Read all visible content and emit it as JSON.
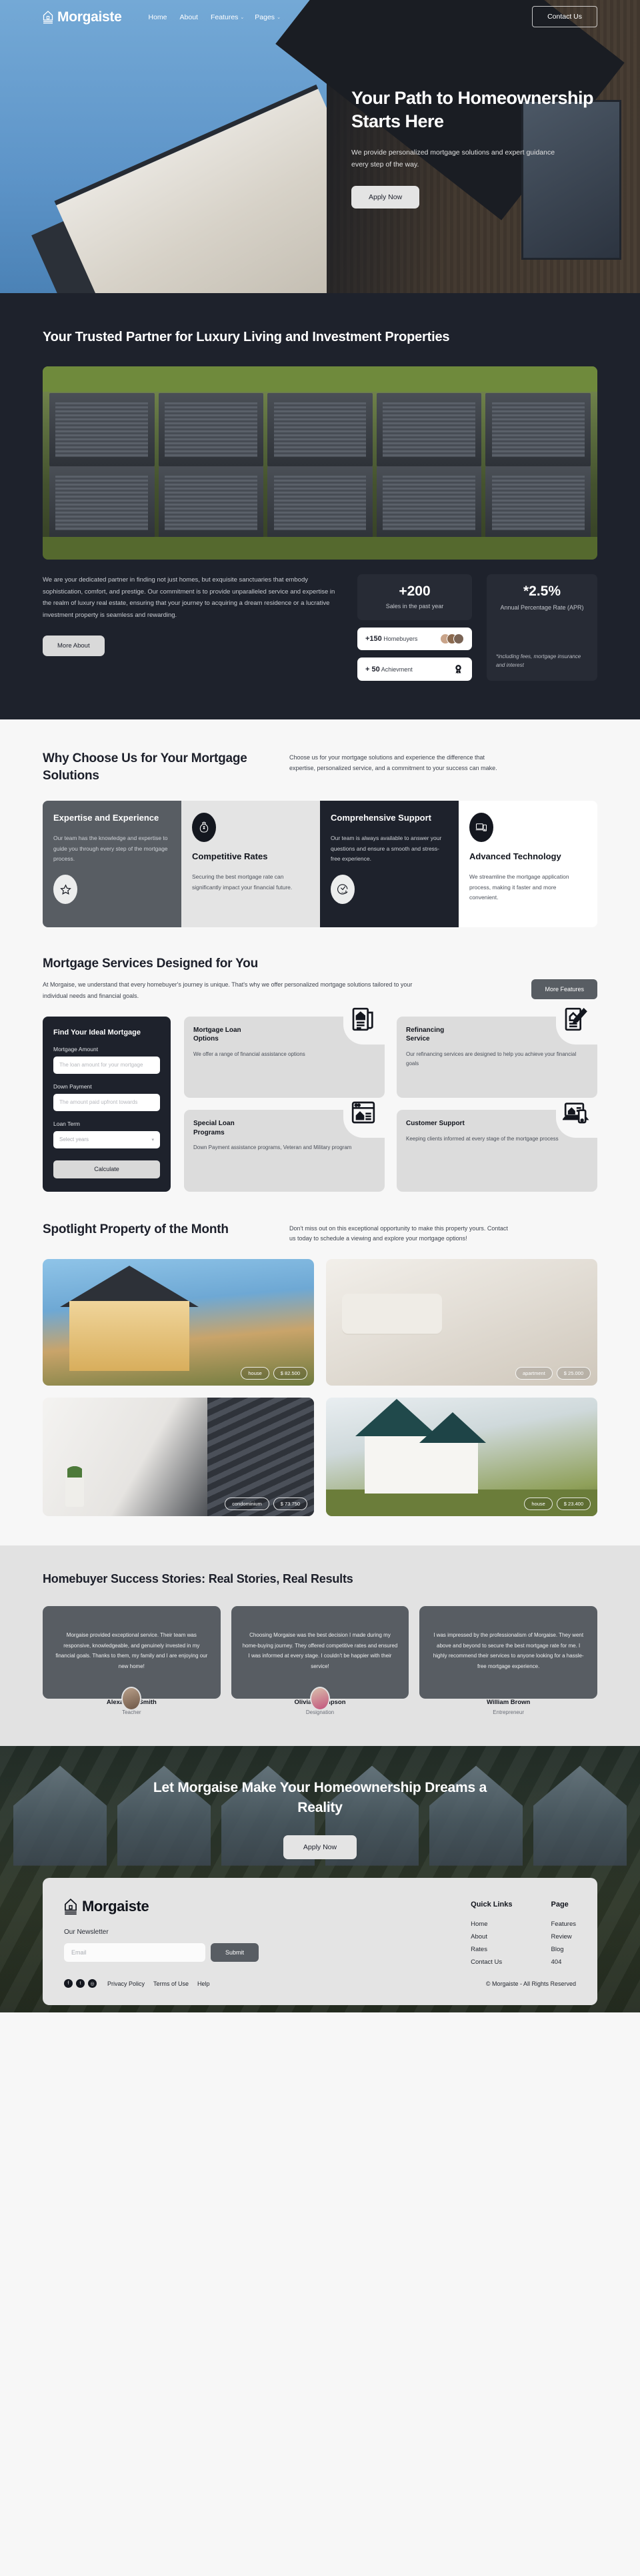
{
  "brand": {
    "name": "Morgaiste",
    "icon": "house-logo-icon"
  },
  "nav": {
    "links": [
      {
        "label": "Home",
        "caret": ""
      },
      {
        "label": "About",
        "caret": ""
      },
      {
        "label": "Features",
        "caret": "⌄"
      },
      {
        "label": "Pages",
        "caret": "⌄"
      }
    ],
    "cta": "Contact Us"
  },
  "hero": {
    "title": "Your Path to Homeownership Starts Here",
    "subtitle": "We provide personalized mortgage solutions and expert guidance every step of the way.",
    "cta": "Apply Now"
  },
  "about": {
    "heading": "Your Trusted Partner for Luxury Living and Investment Properties",
    "body": "We are your dedicated partner in finding not just homes, but exquisite sanctuaries that embody sophistication, comfort, and prestige. Our commitment is to provide unparalleled service and expertise in the realm of luxury real estate, ensuring that your journey to acquiring a dream residence or a lucrative investment property is seamless and rewarding.",
    "cta": "More About",
    "stat_sales_value": "+200",
    "stat_sales_label": "Sales in the past year",
    "pill_homebuyers_value": "+150",
    "pill_homebuyers_label": "Homebuyers",
    "pill_achievement_value": "+ 50",
    "pill_achievement_label": "Achievment",
    "apr_value": "*2.5%",
    "apr_label": "Annual Percentage Rate (APR)",
    "apr_note": "*including fees, mortgage insurance and interest"
  },
  "why": {
    "heading": "Why Choose Us for Your Mortgage Solutions",
    "body": "Choose us for your mortgage solutions and experience the difference that expertise, personalized service, and a commitment to your success can make.",
    "cards": [
      {
        "title": "Expertise and Experience",
        "body": "Our team has the knowledge and expertise to guide you through every step of the mortgage process.",
        "icon": "star-icon"
      },
      {
        "title": "Competitive Rates",
        "body": "Securing the best mortgage rate can significantly impact your financial future.",
        "icon": "money-bag-icon"
      },
      {
        "title": "Comprehensive Support",
        "body": "Our team is always available to answer your questions and ensure a smooth and stress-free experience.",
        "icon": "24-hour-clock-icon"
      },
      {
        "title": "Advanced Technology",
        "body": "We streamline the mortgage application process, making it faster and more convenient.",
        "icon": "devices-icon"
      }
    ]
  },
  "services": {
    "heading": "Mortgage Services Designed for You",
    "body": "At Morgaise, we understand that every homebuyer's journey is unique. That's why we offer personalized mortgage solutions tailored to your individual needs and financial goals.",
    "cta": "More Features",
    "calculator": {
      "title": "Find Your Ideal Mortgage",
      "amount_label": "Mortgage Amount",
      "amount_placeholder": "The loan amount for your mortgage",
      "down_label": "Down Payment",
      "down_placeholder": "The amount paid upfront towards",
      "term_label": "Loan Term",
      "term_value": "Select years",
      "submit": "Calculate"
    },
    "cards": [
      {
        "title": "Mortgage Loan Options",
        "body": "We offer a range of financial assistance options",
        "icon": "document-house-icon"
      },
      {
        "title": "Refinancing Service",
        "body": "Our refinancing services are designed to help you achieve your financial goals",
        "icon": "clipboard-pen-icon"
      },
      {
        "title": "Special Loan Programs",
        "body": "Down Payment assistance programs, Veteran and Military program",
        "icon": "browser-house-icon"
      },
      {
        "title": "Customer Support",
        "body": "Keeping clients informed at every stage of the mortgage process",
        "icon": "laptop-phone-icon"
      }
    ]
  },
  "spotlight": {
    "heading": "Spotlight Property of the Month",
    "body": "Don't miss out on this exceptional opportunity to make this property yours. Contact us today to schedule a viewing and explore your mortgage options!",
    "properties": [
      {
        "type": "house",
        "price": "$ 82.500"
      },
      {
        "type": "apartment",
        "price": "$ 25.000"
      },
      {
        "type": "condominium",
        "price": "$ 73.750"
      },
      {
        "type": "house",
        "price": "$ 23.400"
      }
    ]
  },
  "testimonials": {
    "heading": "Homebuyer Success Stories: Real Stories, Real Results",
    "items": [
      {
        "quote": "Morgaise provided exceptional service. Their team was responsive, knowledgeable, and genuinely invested in my financial goals. Thanks to them, my family and I are enjoying our new home!",
        "name": "Alexander Smith",
        "role": "Teacher"
      },
      {
        "quote": "Choosing Morgaise was the best decision I made during my home-buying journey. They offered competitive rates and ensured I was informed at every stage. I couldn't be happier with their service!",
        "name": "Olivia Thompson",
        "role": "Designation"
      },
      {
        "quote": "I was impressed by the professionalism of Morgaise. They went above and beyond to secure the best mortgage rate for me. I highly recommend their services to anyone looking for a hassle-free mortgage experience.",
        "name": "William Brown",
        "role": "Entrepreneur"
      }
    ]
  },
  "cta": {
    "heading": "Let Morgaise Make Your Homeownership Dreams a Reality",
    "button": "Apply Now"
  },
  "footer": {
    "newsletter_label": "Our Newsletter",
    "email_placeholder": "Email",
    "submit": "Submit",
    "quick_links_title": "Quick Links",
    "quick_links": [
      "Home",
      "About",
      "Rates",
      "Contact Us"
    ],
    "page_title": "Page",
    "page_links": [
      "Features",
      "Review",
      "Blog",
      "404"
    ],
    "legal": [
      "Privacy Policy",
      "Terms of Use",
      "Help"
    ],
    "socials": [
      "facebook-icon",
      "twitter-icon",
      "instagram-icon"
    ],
    "copyright": "©  Morgaiste - All Rights Reserved"
  }
}
